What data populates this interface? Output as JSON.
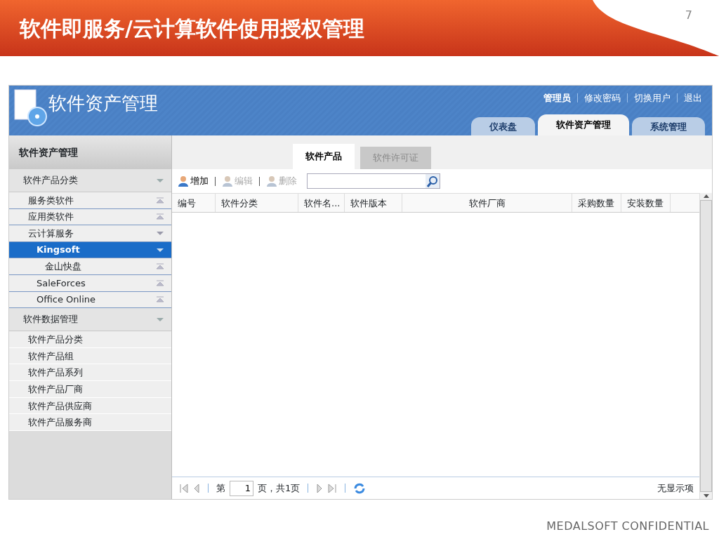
{
  "slide": {
    "title": "软件即服务/云计算软件使用授权管理",
    "page_number": "7",
    "footer": "MEDALSOFT CONFIDENTIAL"
  },
  "app": {
    "title": "软件资产管理",
    "user_links": [
      {
        "label": "管理员",
        "kind": "user"
      },
      {
        "label": "修改密码",
        "kind": "link"
      },
      {
        "label": "切换用户",
        "kind": "link"
      },
      {
        "label": "退出",
        "kind": "link"
      }
    ],
    "tabs": [
      {
        "label": "仪表盘",
        "selected": false
      },
      {
        "label": "软件资产管理",
        "selected": true
      },
      {
        "label": "系统管理",
        "selected": false
      }
    ],
    "sidebar": {
      "title": "软件资产管理",
      "groups": [
        {
          "label": "软件产品分类",
          "kind": "tree",
          "items": [
            {
              "label": "服务类软件",
              "expanded": false,
              "selected": false
            },
            {
              "label": "应用类软件",
              "expanded": false,
              "selected": false
            },
            {
              "label": "云计算服务",
              "expanded": true,
              "selected": false,
              "children": [
                {
                  "label": "Kingsoft",
                  "expanded": true,
                  "selected": true,
                  "children": [
                    {
                      "label": "金山快盘",
                      "expanded": false,
                      "selected": false
                    }
                  ]
                },
                {
                  "label": "SaleForces",
                  "expanded": false,
                  "selected": false
                },
                {
                  "label": "Office Online",
                  "expanded": false,
                  "selected": false
                }
              ]
            }
          ]
        },
        {
          "label": "软件数据管理",
          "kind": "list",
          "items": [
            {
              "label": "软件产品分类"
            },
            {
              "label": "软件产品组"
            },
            {
              "label": "软件产品系列"
            },
            {
              "label": "软件产品厂商"
            },
            {
              "label": "软件产品供应商"
            },
            {
              "label": "软件产品服务商"
            }
          ]
        }
      ]
    },
    "subtabs": [
      {
        "label": "软件产品",
        "selected": true
      },
      {
        "label": "软件许可证",
        "selected": false
      }
    ],
    "toolbar": [
      {
        "label": "增加",
        "disabled": false
      },
      {
        "label": "编辑",
        "disabled": true
      },
      {
        "label": "删除",
        "disabled": true
      }
    ],
    "table": {
      "columns": [
        "编号",
        "软件分类",
        "软件名...",
        "软件版本",
        "软件厂商",
        "采购数量",
        "安装数量"
      ]
    },
    "pager": {
      "page_prefix": "第",
      "page": "1",
      "page_suffix": "页，共1页",
      "status": "无显示项"
    }
  }
}
